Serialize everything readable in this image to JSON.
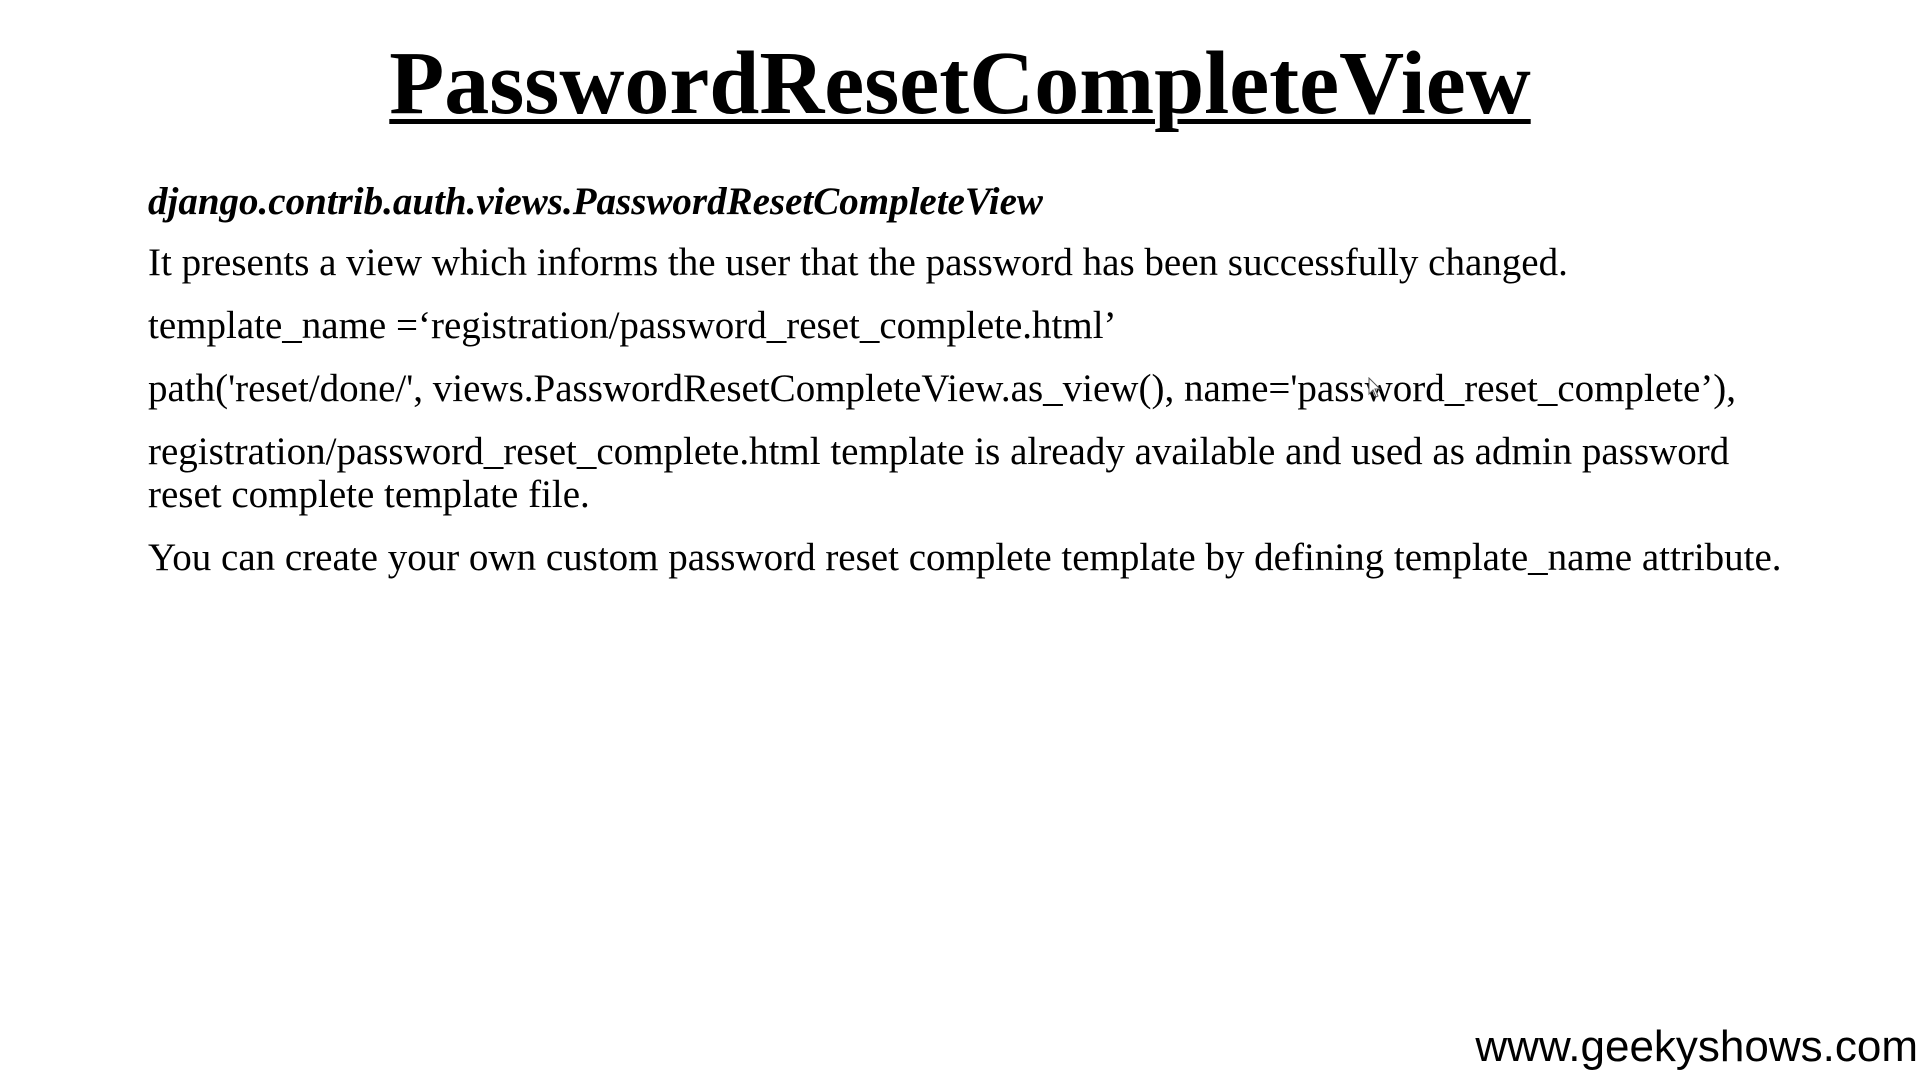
{
  "slide": {
    "title": "PasswordResetCompleteView",
    "subtitle": "django.contrib.auth.views.PasswordResetCompleteView",
    "paragraphs": [
      "It presents a view which informs the user that the password has been successfully changed.",
      "template_name =‘registration/password_reset_complete.html’",
      "path('reset/done/', views.PasswordResetCompleteView.as_view(), name='password_reset_complete’),",
      "registration/password_reset_complete.html template is already available and used as admin password reset complete template file.",
      "You can create your own custom password reset complete template by defining template_name attribute."
    ],
    "footer": "www.geekyshows.com"
  },
  "icons": {
    "cursor": "mouse-pointer-icon"
  }
}
